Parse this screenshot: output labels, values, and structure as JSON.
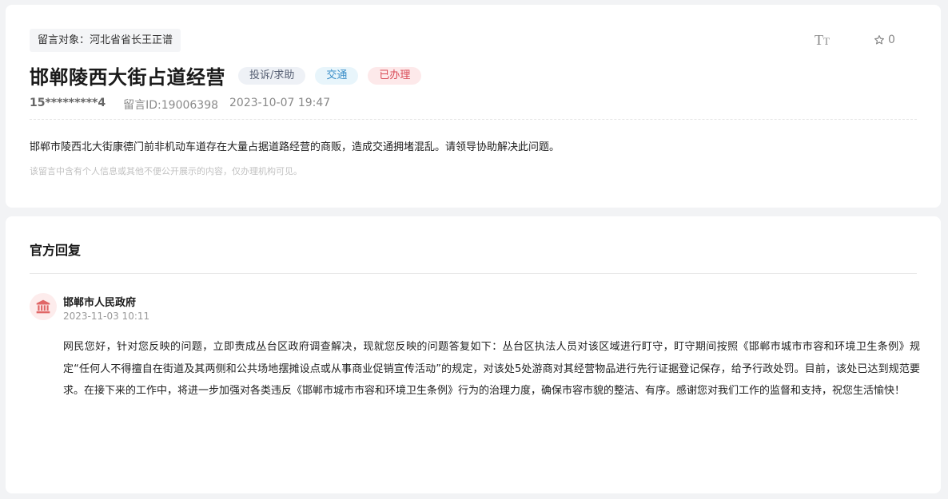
{
  "message": {
    "target_label": "留言对象：河北省省长王正谱",
    "title": "邯郸陵西大街占道经营",
    "tags": {
      "type": "投诉/求助",
      "category": "交通",
      "status": "已办理"
    },
    "toolbar": {
      "font_big": "T",
      "font_small": "T",
      "favorite_count": "0"
    },
    "user": "15*********4",
    "message_id": "留言ID:19006398",
    "datetime": "2023-10-07 19:47",
    "content": "邯郸市陵西北大街康德门前非机动车道存在大量占据道路经营的商贩，造成交通拥堵混乱。请领导协助解决此问题。",
    "privacy_note": "该留言中含有个人信息或其他不便公开展示的内容，仅办理机构可见。"
  },
  "reply": {
    "heading": "官方回复",
    "org_name": "邯郸市人民政府",
    "datetime": "2023-11-03 10:11",
    "content": "网民您好，针对您反映的问题，立即责成丛台区政府调查解决，现就您反映的问题答复如下：丛台区执法人员对该区域进行盯守，盯守期间按照《邯郸市城市市容和环境卫生条例》规定“任何人不得擅自在街道及其两侧和公共场地摆摊设点或从事商业促销宣传活动”的规定，对该处5处游商对其经营物品进行先行证据登记保存，给予行政处罚。目前，该处已达到规范要求。在接下来的工作中，将进一步加强对各类违反《邯郸市城市市容和环境卫生条例》行为的治理力度，确保市容市貌的整洁、有序。感谢您对我们工作的监督和支持，祝您生活愉快！"
  },
  "icons": {
    "font_size": "font-size-icon",
    "favorite": "star-outline-icon",
    "avatar": "government-building-icon"
  },
  "colors": {
    "status_red": "#d94b57",
    "category_blue": "#3b8ec8",
    "avatar_red": "#e06666"
  }
}
